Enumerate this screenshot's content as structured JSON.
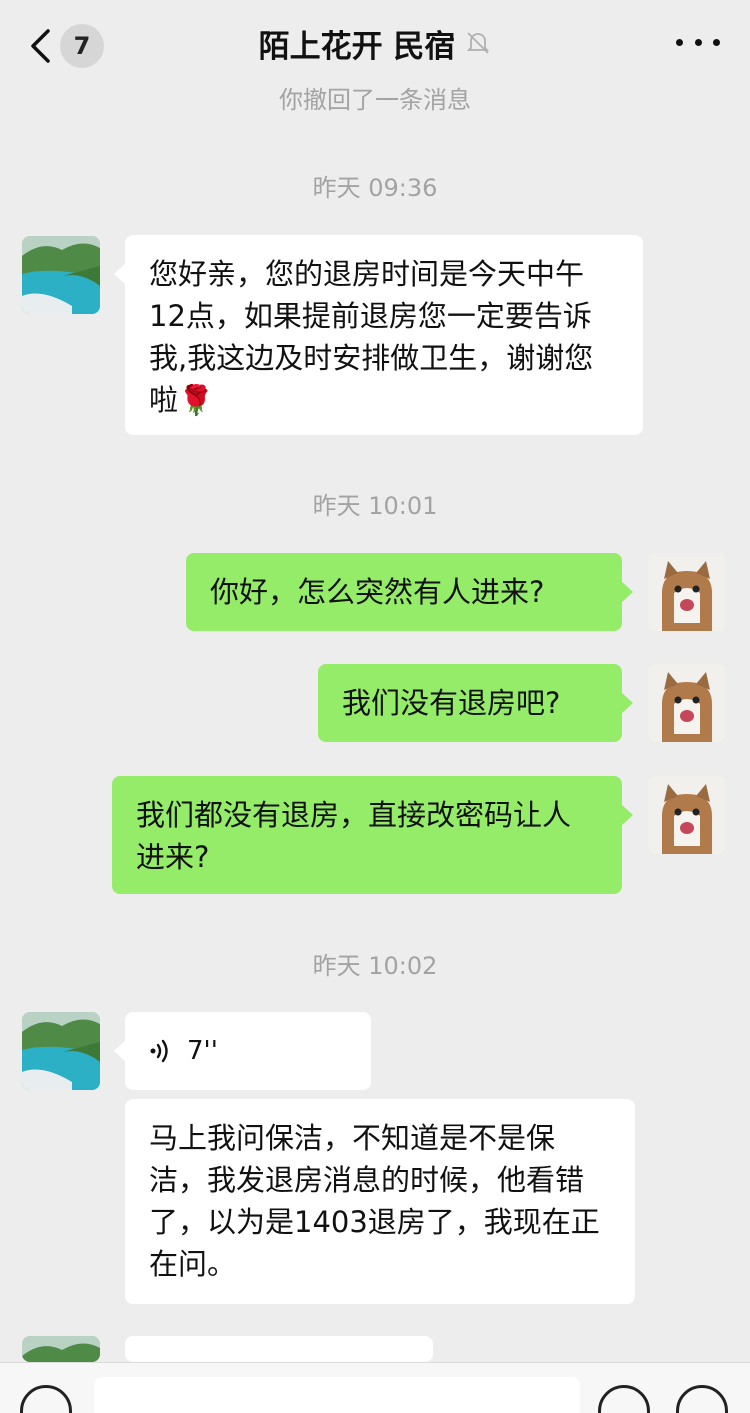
{
  "header": {
    "unread_count": "7",
    "title": "陌上花开 民宿"
  },
  "messages": {
    "recall_notice": "你撤回了一条消息",
    "time1": "昨天 09:36",
    "msg1": "您好亲，您的退房时间是今天中午12点，如果提前退房您一定要告诉我,我这边及时安排做卫生，谢谢您啦🌹",
    "time2": "昨天 10:01",
    "msg2": "你好，怎么突然有人进来?",
    "msg3": "我们没有退房吧?",
    "msg4": "我们都没有退房，直接改密码让人进来?",
    "time3": "昨天 10:02",
    "voice_duration": "7''",
    "msg5": "马上我问保洁，不知道是不是保洁，我发退房消息的时候，他看错了，以为是1403退房了，我现在正在问。"
  },
  "colors": {
    "background": "#ededed",
    "outgoing_bubble": "#95ec69",
    "incoming_bubble": "#ffffff",
    "system_text": "#a3a3a3"
  },
  "icons": {
    "back": "chevron-left-icon",
    "mute": "bell-off-icon",
    "more": "more-dots-icon",
    "voice_wave": "voice-wave-icon",
    "voice_input": "voice-input-icon",
    "emoji": "emoji-icon",
    "plus": "plus-icon"
  }
}
